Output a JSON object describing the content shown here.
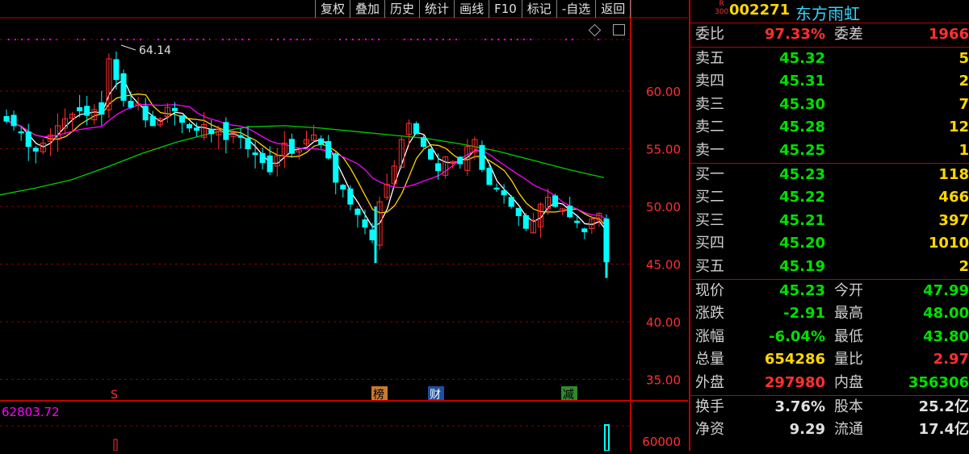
{
  "toolbar": [
    "复权",
    "叠加",
    "历史",
    "统计",
    "画线",
    "F10",
    "标记",
    "-自选",
    "返回"
  ],
  "stock": {
    "code": "002271",
    "name": "东方雨虹",
    "badge_top": "R",
    "badge_bottom": "300"
  },
  "chart_data": {
    "type": "candlestick",
    "price_ticks": [
      "60.00",
      "55.00",
      "50.00",
      "45.00",
      "40.00",
      "35.00"
    ],
    "volume_ticks": [
      "60000"
    ],
    "high_marker": "64.14",
    "volume_label": "62803.72",
    "event_markers": [
      "S",
      "榜",
      "财",
      "减"
    ],
    "colors": {
      "up": "#ff3030",
      "down": "#00ffff",
      "ma5": "#ffffff",
      "ma10": "#ffd700",
      "ma20": "#ff00ff",
      "ma60": "#00d000"
    },
    "ylim": [
      33,
      66
    ]
  },
  "commission": {
    "ratio_label": "委比",
    "ratio": "97.33%",
    "diff_label": "委差",
    "diff": "1966"
  },
  "sell": [
    {
      "label": "卖五",
      "price": "45.32",
      "vol": "5"
    },
    {
      "label": "卖四",
      "price": "45.31",
      "vol": "2"
    },
    {
      "label": "卖三",
      "price": "45.30",
      "vol": "7"
    },
    {
      "label": "卖二",
      "price": "45.28",
      "vol": "12"
    },
    {
      "label": "卖一",
      "price": "45.25",
      "vol": "1"
    }
  ],
  "buy": [
    {
      "label": "买一",
      "price": "45.23",
      "vol": "118"
    },
    {
      "label": "买二",
      "price": "45.22",
      "vol": "466"
    },
    {
      "label": "买三",
      "price": "45.21",
      "vol": "397"
    },
    {
      "label": "买四",
      "price": "45.20",
      "vol": "1010"
    },
    {
      "label": "买五",
      "price": "45.19",
      "vol": "2"
    }
  ],
  "stats": [
    {
      "l1": "现价",
      "v1": "45.23",
      "c1": "g",
      "l2": "今开",
      "v2": "47.99",
      "c2": "g"
    },
    {
      "l1": "涨跌",
      "v1": "-2.91",
      "c1": "g",
      "l2": "最高",
      "v2": "48.00",
      "c2": "g"
    },
    {
      "l1": "涨幅",
      "v1": "-6.04%",
      "c1": "g",
      "l2": "最低",
      "v2": "43.80",
      "c2": "g"
    },
    {
      "l1": "总量",
      "v1": "654286",
      "c1": "y",
      "l2": "量比",
      "v2": "2.97",
      "c2": "r"
    },
    {
      "l1": "外盘",
      "v1": "297980",
      "c1": "r",
      "l2": "内盘",
      "v2": "356306",
      "c2": "g"
    }
  ],
  "fundamentals": [
    {
      "l1": "换手",
      "v1": "3.76%",
      "l2": "股本",
      "v2": "25.2亿"
    },
    {
      "l1": "净资",
      "v1": "9.29",
      "l2": "流通",
      "v2": "17.4亿"
    }
  ]
}
